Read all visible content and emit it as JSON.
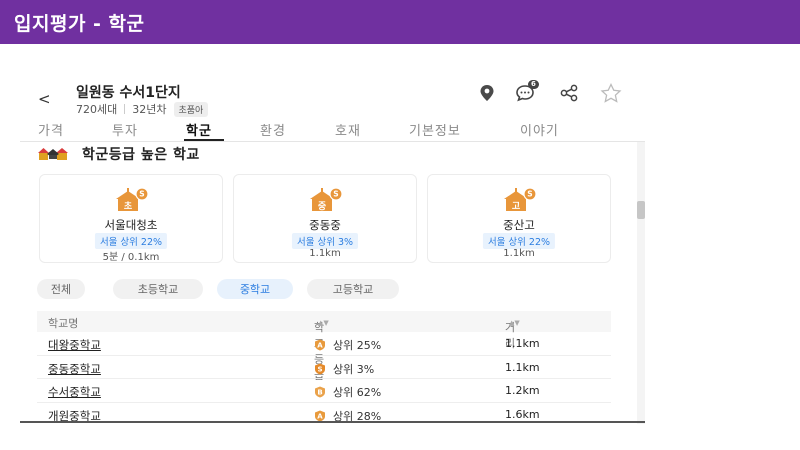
{
  "slide": {
    "title": "입지평가 - 학군"
  },
  "header": {
    "back_label": "<",
    "complex_name": "일원동 수서1단지",
    "households": "720세대",
    "age": "32년차",
    "school_badge": "초품아",
    "chat_count": "6"
  },
  "tabs": [
    {
      "label": "가격"
    },
    {
      "label": "투자"
    },
    {
      "label": "학군"
    },
    {
      "label": "환경"
    },
    {
      "label": "호재"
    },
    {
      "label": "기본정보"
    },
    {
      "label": "이야기"
    }
  ],
  "section": {
    "title": "학군등급 높은 학교"
  },
  "cards": [
    {
      "icon_char": "초",
      "name": "서울대청초",
      "rank": "서울 상위 22%",
      "distance": "5분 / 0.1km"
    },
    {
      "icon_char": "중",
      "name": "중동중",
      "rank": "서울 상위 3%",
      "distance": "1.1km"
    },
    {
      "icon_char": "고",
      "name": "중산고",
      "rank": "서울 상위 22%",
      "distance": "1.1km"
    }
  ],
  "filters": [
    {
      "label": "전체"
    },
    {
      "label": "초등학교"
    },
    {
      "label": "중학교"
    },
    {
      "label": "고등학교"
    }
  ],
  "table": {
    "headers": {
      "name": "학교명",
      "grade": "학교등급",
      "distance": "거리"
    },
    "rows": [
      {
        "name": "대왕중학교",
        "badge": "A",
        "badge_color": "#e89a3c",
        "grade": "상위 25%",
        "distance": "1.1km"
      },
      {
        "name": "중동중학교",
        "badge": "S",
        "badge_color": "#e58a2a",
        "grade": "상위 3%",
        "distance": "1.1km"
      },
      {
        "name": "수서중학교",
        "badge": "B",
        "badge_color": "#eaa24a",
        "grade": "상위 62%",
        "distance": "1.2km"
      },
      {
        "name": "개원중학교",
        "badge": "A",
        "badge_color": "#e89a3c",
        "grade": "상위 28%",
        "distance": "1.6km"
      }
    ]
  },
  "colors": {
    "header_bg": "#7030a0",
    "accent_blue": "#2b7de0",
    "school_orange": "#e8963a"
  }
}
